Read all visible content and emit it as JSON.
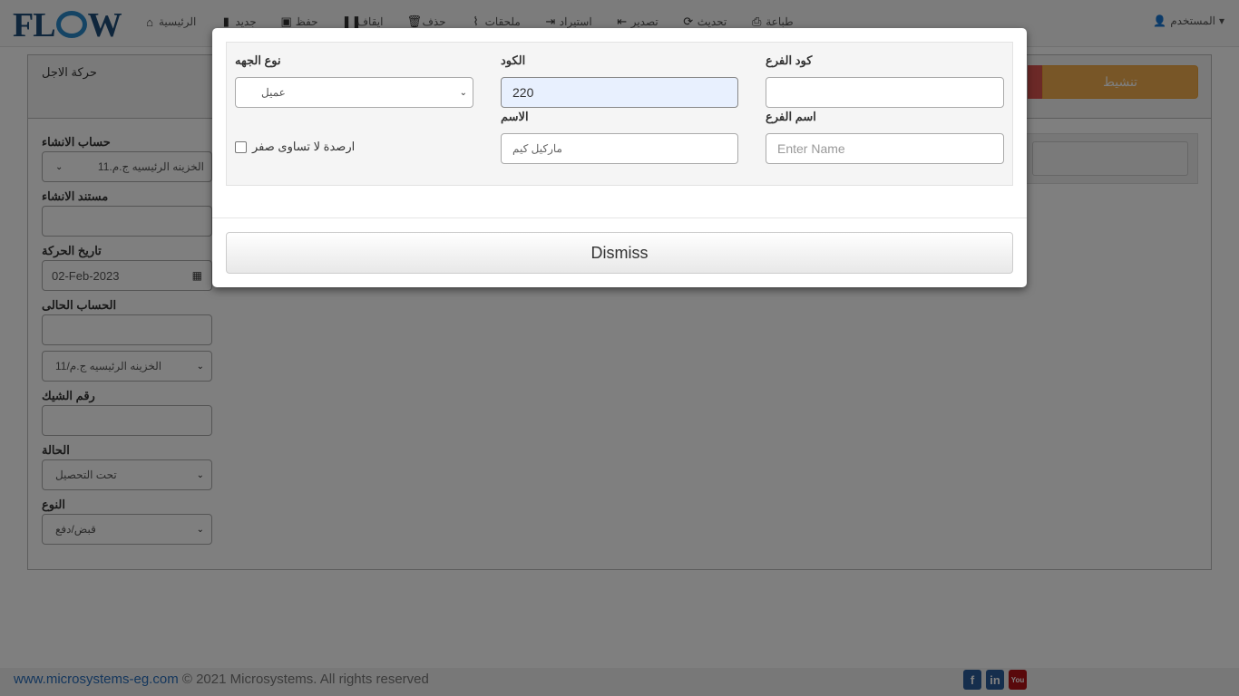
{
  "app": {
    "logo": {
      "left": "FL",
      "right": "W"
    }
  },
  "navbar": {
    "items": [
      {
        "label": "الرئيسية",
        "icon": "home-icon",
        "glyph": "⌂"
      },
      {
        "label": "جديد",
        "icon": "file-icon",
        "glyph": "▮"
      },
      {
        "label": "حفظ",
        "icon": "floppy-icon",
        "glyph": "▣"
      },
      {
        "label": "ايقاف",
        "icon": "pause-icon",
        "glyph": "❚❚"
      },
      {
        "label": "حذف",
        "icon": "trash-icon",
        "glyph": "🗑"
      },
      {
        "label": "ملحقات",
        "icon": "paperclip-icon",
        "glyph": "⌇"
      },
      {
        "label": "استيراد",
        "icon": "import-icon",
        "glyph": "⇥"
      },
      {
        "label": "تصدير",
        "icon": "export-icon",
        "glyph": "⇤"
      },
      {
        "label": "تحديث",
        "icon": "refresh-icon",
        "glyph": "⟳"
      },
      {
        "label": "طباعة",
        "icon": "printer-icon",
        "glyph": "⎙"
      }
    ],
    "user": {
      "label": "المستخدم",
      "icon": "user-icon",
      "caret": "▾"
    }
  },
  "page": {
    "title": "حركة الاجل",
    "activate_label": "تنشيط",
    "fields": {
      "create_account_label": "حساب الانشاء",
      "create_account_value": "الخزينه الرئيسيه ج.م.11",
      "create_doc_label": "مستند الانشاء",
      "create_doc_value": "",
      "move_date_label": "تاريخ الحركة",
      "move_date_value": "02-Feb-2023",
      "current_account_label": "الحساب الحالى",
      "current_account_value": "",
      "current_account_select": "الخزينه الرئيسيه ج.م/11",
      "cheque_no_label": "رقم الشيك",
      "cheque_no_value": "",
      "status_label": "الحالة",
      "status_value": "تحت التحصيل",
      "type_label": "النوع",
      "type_value": "قبض/دفع"
    }
  },
  "modal": {
    "entity_type_label": "نوع الجهه",
    "entity_type_value": "عميل",
    "code_label": "الكود",
    "code_value": "220",
    "branch_code_label": "كود الفرع",
    "branch_code_value": "",
    "name_label": "الاسم",
    "name_value": "ماركيل كيم",
    "branch_name_label": "اسم الفرع",
    "branch_name_placeholder": "Enter Name",
    "nonzero_balance_label": "ارصدة لا تساوى صفر",
    "nonzero_balance_checked": false,
    "dismiss_label": "Dismiss"
  },
  "footer": {
    "link": "www.microsystems-eg.com",
    "copyright": " © 2021 Microsystems. All rights reserved",
    "social": {
      "facebook": "f",
      "linkedin": "in",
      "youtube": "You"
    }
  },
  "colors": {
    "accent_orange": "#f0ad4e",
    "accent_red": "#d9534f",
    "link_blue": "#2a6ebb",
    "focus_bg": "#e8f0fe"
  }
}
